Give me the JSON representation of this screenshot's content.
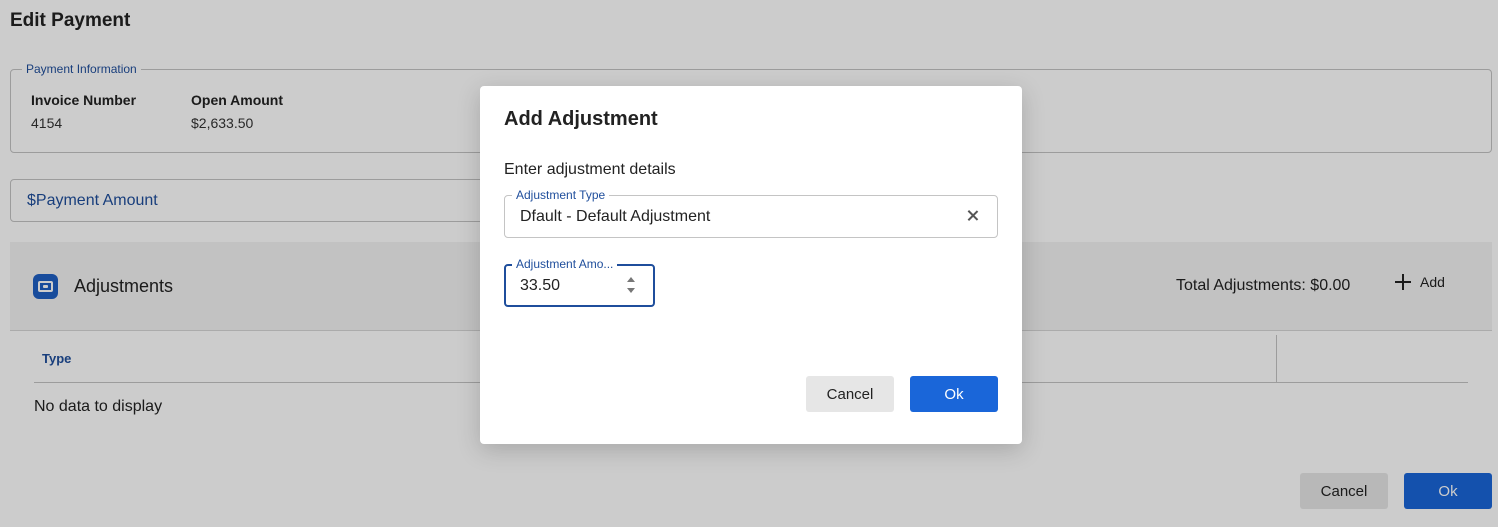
{
  "page": {
    "title": "Edit Payment"
  },
  "payment_info": {
    "legend": "Payment Information",
    "invoice_number_label": "Invoice Number",
    "invoice_number_value": "4154",
    "open_amount_label": "Open Amount",
    "open_amount_value": "$2,633.50"
  },
  "payment_amount": {
    "placeholder": "$Payment Amount"
  },
  "adjustments": {
    "title": "Adjustments",
    "total_label": "Total Adjustments: $0.00",
    "add_label": "Add",
    "icon": "payment-card-icon",
    "table": {
      "columns": [
        "Type"
      ],
      "empty_text": "No data to display"
    }
  },
  "footer": {
    "cancel_label": "Cancel",
    "ok_label": "Ok"
  },
  "modal": {
    "title": "Add Adjustment",
    "subtitle": "Enter adjustment details",
    "adjustment_type": {
      "label": "Adjustment Type",
      "value": "Dfault - Default Adjustment"
    },
    "adjustment_amount": {
      "label": "Adjustment Amo...",
      "value": "33.50"
    },
    "cancel_label": "Cancel",
    "ok_label": "Ok"
  },
  "colors": {
    "accent": "#1a66d9",
    "label_blue": "#1f4e9c",
    "overlay": "rgba(0,0,0,0.2)"
  }
}
